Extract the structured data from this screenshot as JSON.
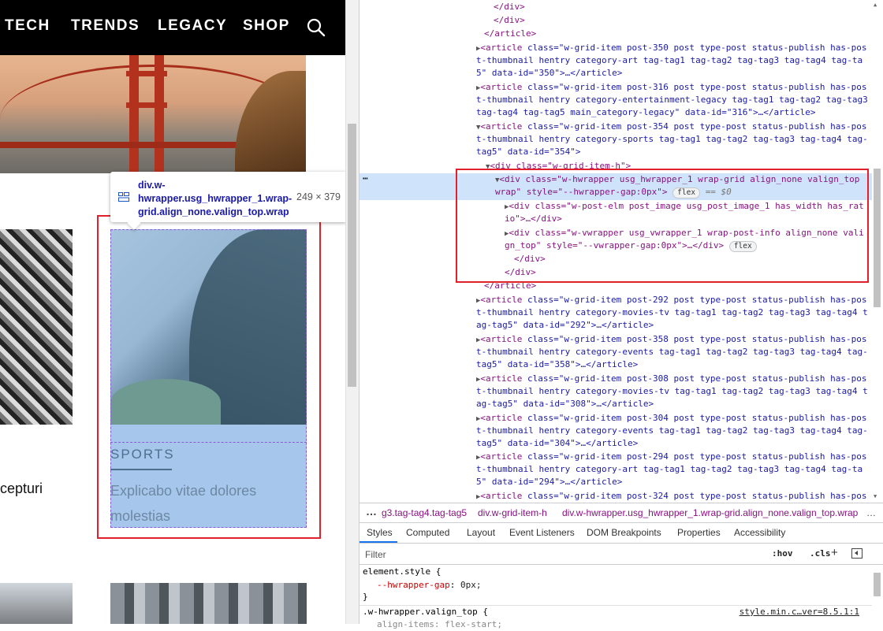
{
  "site": {
    "nav": [
      "TECH",
      "TRENDS",
      "LEGACY",
      "SHOP"
    ],
    "left_card_text": "cepturi",
    "highlighted_card": {
      "category": "SPORTS",
      "title": "Explicabo vitae dolores molestias"
    },
    "tooltip": {
      "selector": "div.w-hwrapper.usg_hwrapper_1.wrap-grid.align_none.valign_top.wrap",
      "size": "249 × 379"
    }
  },
  "devtools": {
    "dom_lines": [
      {
        "indent": 22,
        "html": "</div>"
      },
      {
        "indent": 20,
        "html": "</div>"
      },
      {
        "indent": 18,
        "html": "</article>"
      }
    ],
    "articles_before": [
      {
        "line1": "class=\"w-grid-item post-350 post type-post status-publish has-pos",
        "line2": "t-thumbnail hentry category-art tag-tag1 tag-tag2 tag-tag3 tag-tag4 tag-ta",
        "line3": "5\" data-id=\"350\">…</article>"
      },
      {
        "line1": "class=\"w-grid-item post-316 post type-post status-publish has-pos",
        "line2": "t-thumbnail hentry category-entertainment-legacy tag-tag1 tag-tag2 tag-tag3",
        "line3": "tag-tag4 tag-tag5 main_category-legacy\" data-id=\"316\">…</article>"
      }
    ],
    "open_article": {
      "line1": "class=\"w-grid-item post-354 post type-post status-publish has-pos",
      "line2": "t-thumbnail hentry category-sports tag-tag1 tag-tag2 tag-tag3 tag-tag4 tag-",
      "line3": "tag5\" data-id=\"354\">",
      "inner_div": "<div class=\"w-grid-item-h\">"
    },
    "selected": {
      "line1": "<div class=\"w-hwrapper usg_hwrapper_1 wrap-grid align_none valign_top",
      "line2_a": "wrap\" style=\"--hwrapper-gap:0px\">",
      "badge": "flex",
      "eq": "== $0"
    },
    "children": [
      {
        "line1": "<div class=\"w-post-elm post_image usg_post_image_1 has_width has_rat",
        "line2": "io\">…</div>"
      },
      {
        "line1": "<div class=\"w-vwrapper usg_vwrapper_1 wrap-post-info align_none vali",
        "line2": "gn_top\" style=\"--vwrapper-gap:0px\">…</div>",
        "badge": "flex"
      }
    ],
    "close_div": "</div>",
    "close_article": "</article>",
    "articles_after": [
      {
        "line1": "class=\"w-grid-item post-292 post type-post status-publish has-pos",
        "line2": "t-thumbnail hentry category-movies-tv tag-tag1 tag-tag2 tag-tag3 tag-tag4 t",
        "line3": "ag-tag5\" data-id=\"292\">…</article>"
      },
      {
        "line1": "class=\"w-grid-item post-358 post type-post status-publish has-pos",
        "line2": "t-thumbnail hentry category-events tag-tag1 tag-tag2 tag-tag3 tag-tag4 tag-",
        "line3": "tag5\" data-id=\"358\">…</article>"
      },
      {
        "line1": "class=\"w-grid-item post-308 post type-post status-publish has-pos",
        "line2": "t-thumbnail hentry category-movies-tv tag-tag1 tag-tag2 tag-tag3 tag-tag4 t",
        "line3": "ag-tag5\" data-id=\"308\">…</article>"
      },
      {
        "line1": "class=\"w-grid-item post-304 post type-post status-publish has-pos",
        "line2": "t-thumbnail hentry category-events tag-tag1 tag-tag2 tag-tag3 tag-tag4 tag-",
        "line3": "tag5\" data-id=\"304\">…</article>"
      },
      {
        "line1": "class=\"w-grid-item post-294 post type-post status-publish has-pos",
        "line2": "t-thumbnail hentry category-art tag-tag1 tag-tag2 tag-tag3 tag-tag4 tag-ta",
        "line3": "5\" data-id=\"294\">…</article>"
      },
      {
        "line1": "class=\"w-grid-item post-324 post type-post status-publish has-pos",
        "line2": "",
        "line3": ""
      }
    ],
    "breadcrumbs": [
      "…",
      "g3.tag-tag4.tag-tag5",
      "div.w-grid-item-h",
      "div.w-hwrapper.usg_hwrapper_1.wrap-grid.align_none.valign_top.wrap",
      "…"
    ],
    "tabs": [
      "Styles",
      "Computed",
      "Layout",
      "Event Listeners",
      "DOM Breakpoints",
      "Properties",
      "Accessibility"
    ],
    "filter_placeholder": "Filter",
    "hov": ":hov",
    "cls": ".cls",
    "styles": {
      "element_style": "element.style {",
      "prop": "--hwrapper-gap",
      "value": "0px;",
      "close": "}",
      "rule2": ".w-hwrapper.valign_top {",
      "source": "style.min.c…ver=8.5.1:1",
      "rule2_prop": "align-items: flex-start;"
    }
  },
  "colors": {
    "highlight": "#a7c6ec",
    "selection": "#cfe3fb",
    "annotation_red": "#e0202a",
    "tag": "#881280",
    "attr_name": "#994500",
    "attr_value": "#1a1aa6"
  }
}
